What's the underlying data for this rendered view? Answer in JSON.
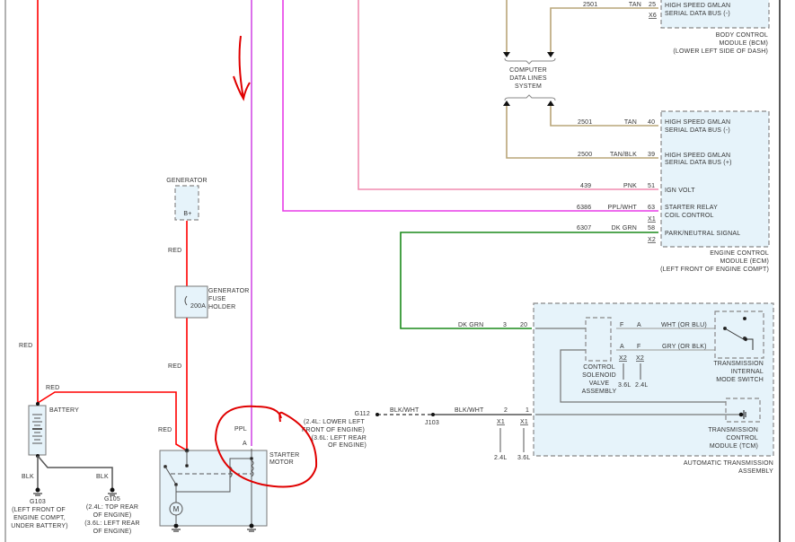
{
  "colors": {
    "red": "#ff0000",
    "tan": "#b9a578",
    "pink": "#f08cb0",
    "magenta": "#e83ce8",
    "ppl": "#d24ce6",
    "dk_grn": "#1a8a1a",
    "gray": "#777777",
    "annotation": "#e00000",
    "module_fill": "#e6f3fa"
  },
  "bcm": {
    "wire": "2501",
    "color": "TAN",
    "pin": "25",
    "connector": "X6",
    "signal": [
      "HIGH SPEED GMLAN",
      "SERIAL DATA BUS (-)"
    ],
    "name": [
      "BODY CONTROL",
      "MODULE (BCM)",
      "(LOWER LEFT SIDE OF DASH)"
    ]
  },
  "data_lines": [
    "COMPUTER",
    "DATA LINES",
    "SYSTEM"
  ],
  "ecm": {
    "circuits": [
      {
        "wire": "2501",
        "color": "TAN",
        "pin": "40",
        "signal": [
          "HIGH SPEED GMLAN",
          "SERIAL DATA BUS (-)"
        ]
      },
      {
        "wire": "2500",
        "color": "TAN/BLK",
        "pin": "39",
        "signal": [
          "HIGH SPEED GMLAN",
          "SERIAL DATA BUS (+)"
        ]
      },
      {
        "wire": "439",
        "color": "PNK",
        "pin": "51",
        "signal": [
          "IGN VOLT"
        ]
      },
      {
        "wire": "6386",
        "color": "PPL/WHT",
        "pin": "63",
        "signal": [
          "STARTER RELAY",
          "COIL CONTROL"
        ]
      },
      {
        "wire": "6307",
        "color": "DK GRN",
        "pin": "58",
        "signal": [
          "PARK/NEUTRAL SIGNAL"
        ]
      }
    ],
    "connectors": [
      "X1",
      "X2"
    ],
    "name": [
      "ENGINE CONTROL",
      "MODULE (ECM)",
      "(LEFT FRONT OF ENGINE COMPT)"
    ]
  },
  "trans": {
    "dk_grn": {
      "color": "DK GRN",
      "pin_a": "3",
      "pin_b": "20"
    },
    "wht": {
      "pin_1": "F",
      "pin_2": "A",
      "color": "WHT (OR BLU)"
    },
    "gry": {
      "pin_1": "A",
      "pin_2": "F",
      "color": "GRY (OR BLK)"
    },
    "x2": [
      {
        "conn": "X2",
        "engine": "3.6L"
      },
      {
        "conn": "X2",
        "engine": "2.4L"
      }
    ],
    "solenoid": [
      "CONTROL",
      "SOLENOID",
      "VALVE",
      "ASSEMBLY"
    ],
    "mode_switch": [
      "TRANSMISSION",
      "INTERNAL",
      "MODE SWITCH"
    ],
    "tcm": [
      "TRANSMISSION",
      "CONTROL",
      "MODULE (TCM)"
    ],
    "assembly": [
      "AUTOMATIC TRANSMISSION",
      "ASSEMBLY"
    ],
    "blkwht": {
      "color_a": "BLK/WHT",
      "splice": "J103",
      "color_b": "BLK/WHT",
      "pin_a": "2",
      "pin_b": "1"
    },
    "x1": [
      {
        "conn": "X1",
        "engine": "2.4L"
      },
      {
        "conn": "X1",
        "engine": "3.6L"
      }
    ]
  },
  "g112": {
    "name": "G112",
    "lines": [
      "(2.4L: LOWER LEFT",
      "FRONT OF ENGINE)",
      "(3.6L: LEFT REAR",
      "OF ENGINE)"
    ]
  },
  "generator": {
    "name": "GENERATOR",
    "terminal": "B+"
  },
  "fuse": {
    "rating": "200A",
    "name": [
      "GENERATOR",
      "FUSE",
      "HOLDER"
    ]
  },
  "battery": {
    "name": "BATTERY"
  },
  "starter": {
    "name": [
      "STARTER",
      "MOTOR"
    ],
    "wire": "PPL",
    "terminal": "A",
    "motor": "M"
  },
  "wire_labels": {
    "red": "RED",
    "blk": "BLK"
  },
  "g103": {
    "name": "G103",
    "lines": [
      "(LEFT FRONT OF",
      "ENGINE COMPT,",
      "UNDER BATTERY)"
    ]
  },
  "g105": {
    "name": "G105",
    "lines": [
      "(2.4L: TOP REAR",
      "OF ENGINE)",
      "(3.6L: LEFT REAR",
      "OF ENGINE)"
    ]
  }
}
